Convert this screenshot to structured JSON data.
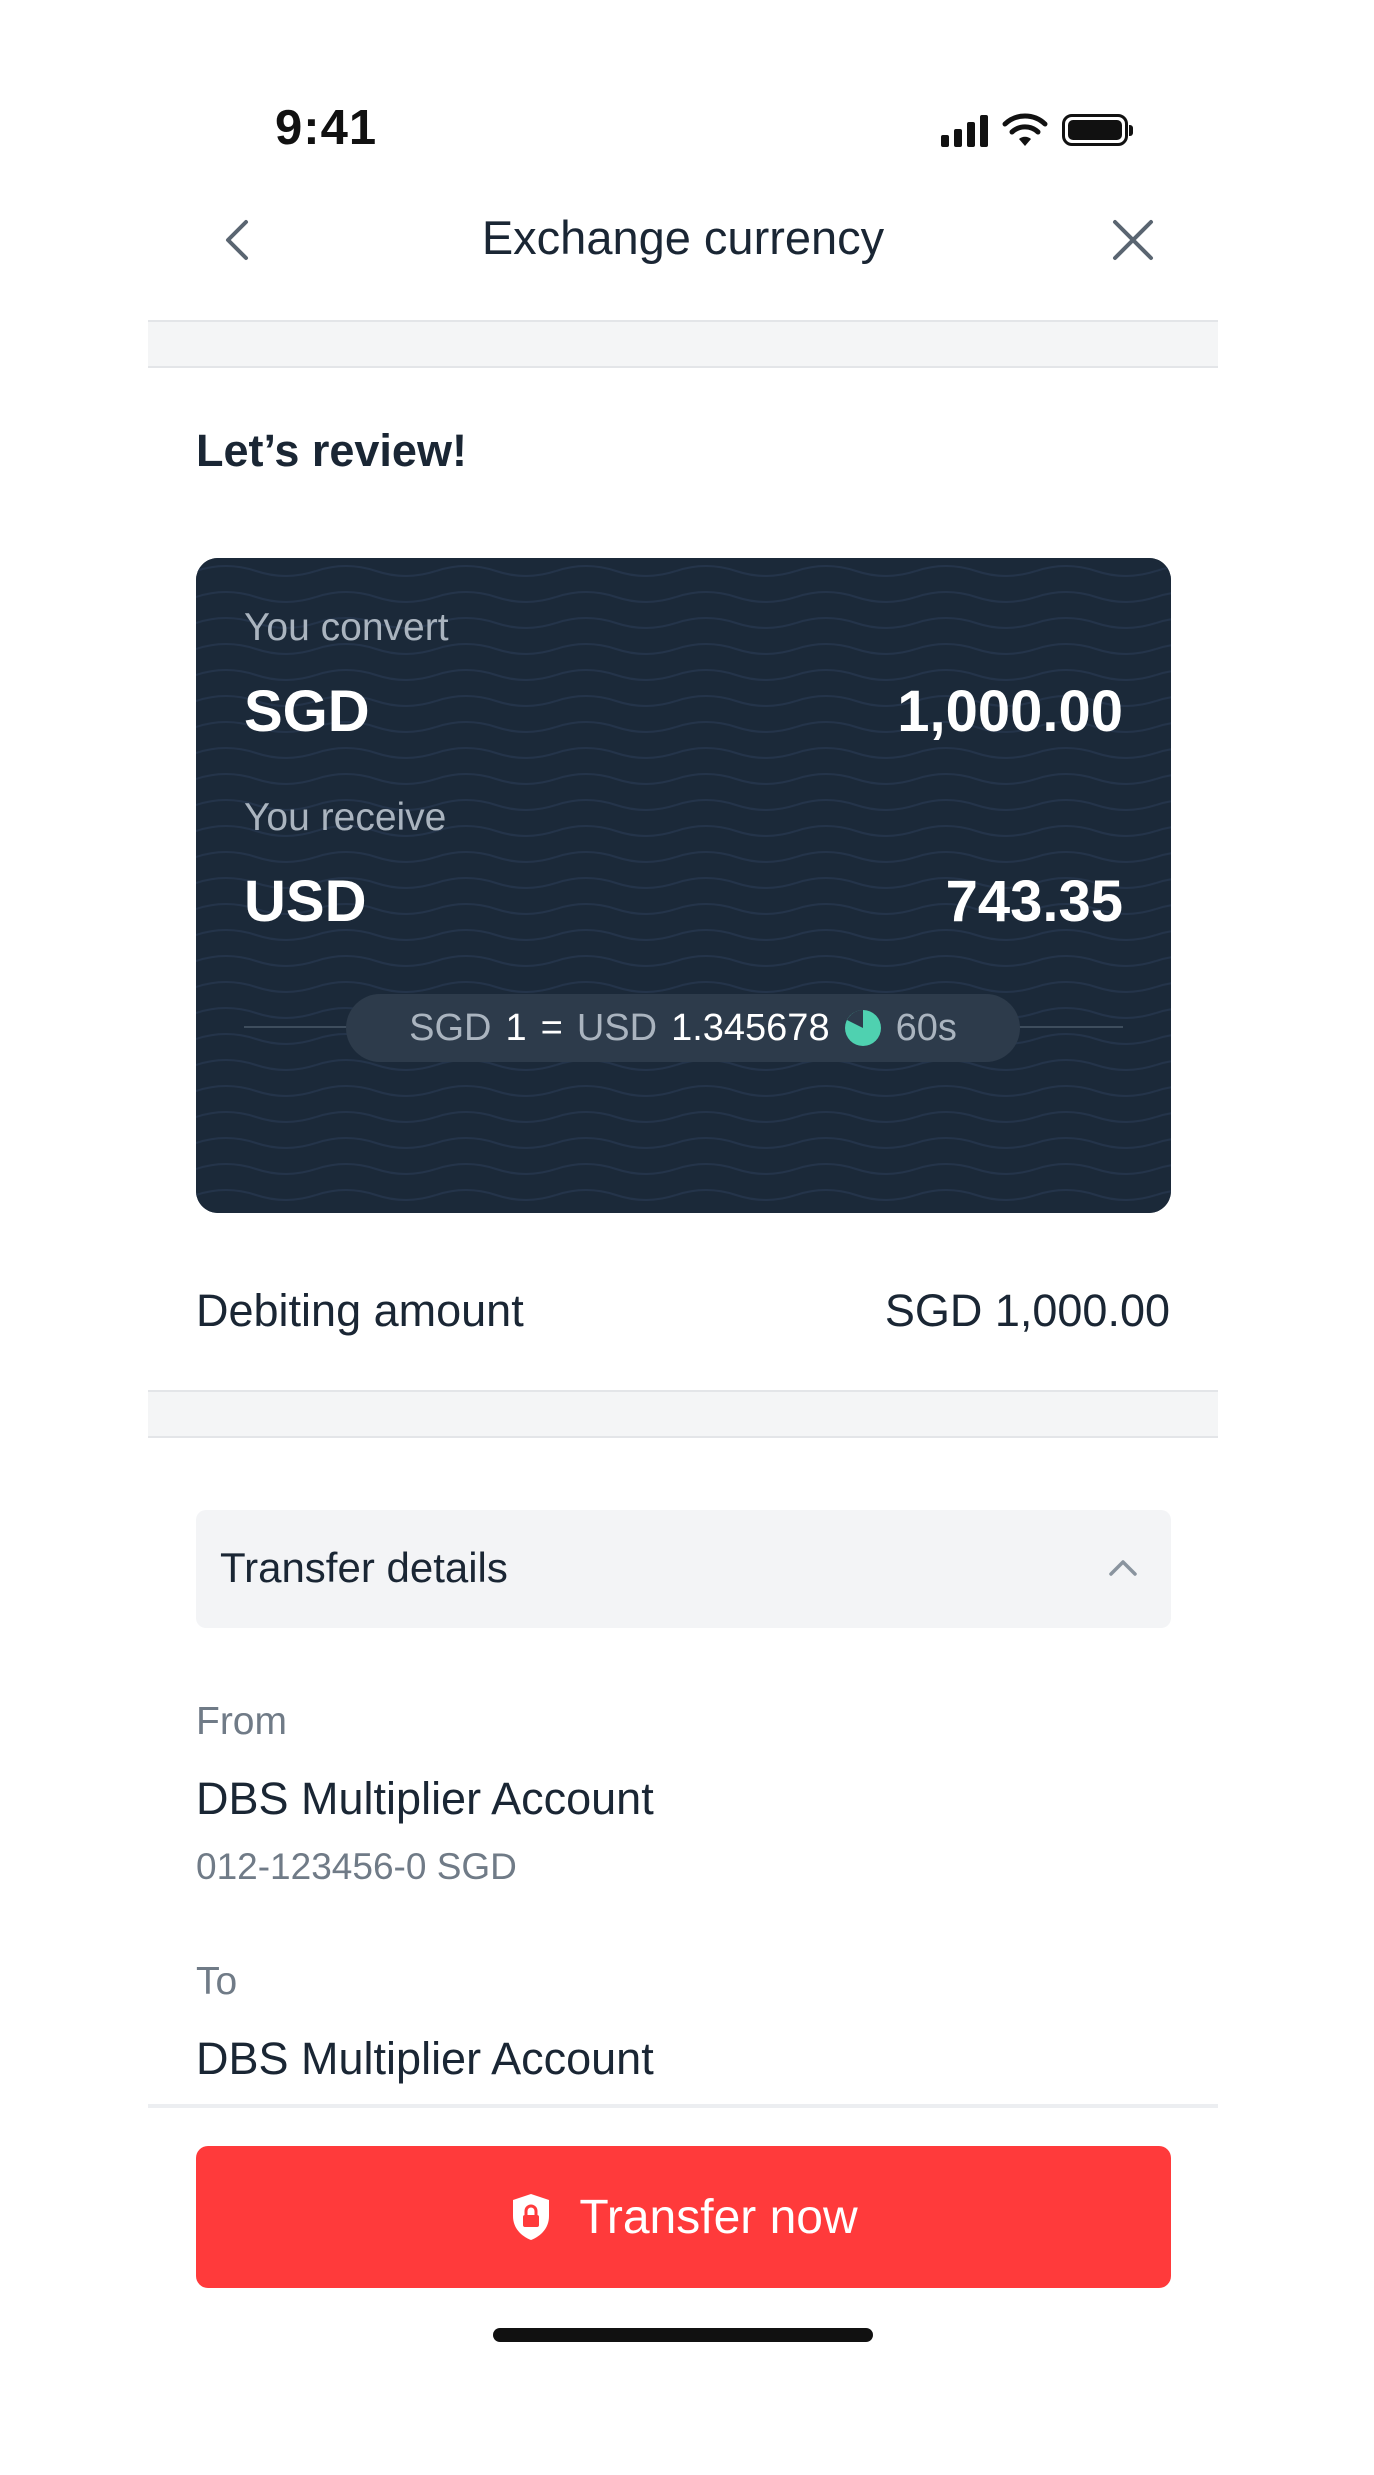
{
  "status_bar": {
    "time": "9:41"
  },
  "nav": {
    "title": "Exchange currency"
  },
  "review": {
    "title": "Let’s review!"
  },
  "fx_card": {
    "convert_label": "You convert",
    "convert_currency": "SGD",
    "convert_amount": "1,000.00",
    "receive_label": "You receive",
    "receive_currency": "USD",
    "receive_amount": "743.35",
    "rate": {
      "from_ccy": "SGD",
      "from_value": "1",
      "equals": "=",
      "to_ccy": "USD",
      "to_value": "1.345678",
      "countdown": "60s"
    }
  },
  "debit": {
    "label": "Debiting amount",
    "value": "SGD 1,000.00"
  },
  "transfer_details": {
    "header": "Transfer details",
    "from_label": "From",
    "from_account": "DBS Multiplier Account",
    "from_number": "012-123456-0 SGD",
    "to_label": "To",
    "to_account": "DBS Multiplier Account"
  },
  "cta": {
    "label": "Transfer now"
  },
  "colors": {
    "card_bg": "#1b2939",
    "accent_red": "#ff3a3b",
    "timer_green": "#4fd1b0",
    "text_dark": "#1a2634",
    "text_muted": "#707b87"
  },
  "icons": [
    "back-chevron-icon",
    "close-icon",
    "timer-icon",
    "chevron-up-icon",
    "shield-lock-icon",
    "signal-icon",
    "wifi-icon",
    "battery-icon"
  ]
}
